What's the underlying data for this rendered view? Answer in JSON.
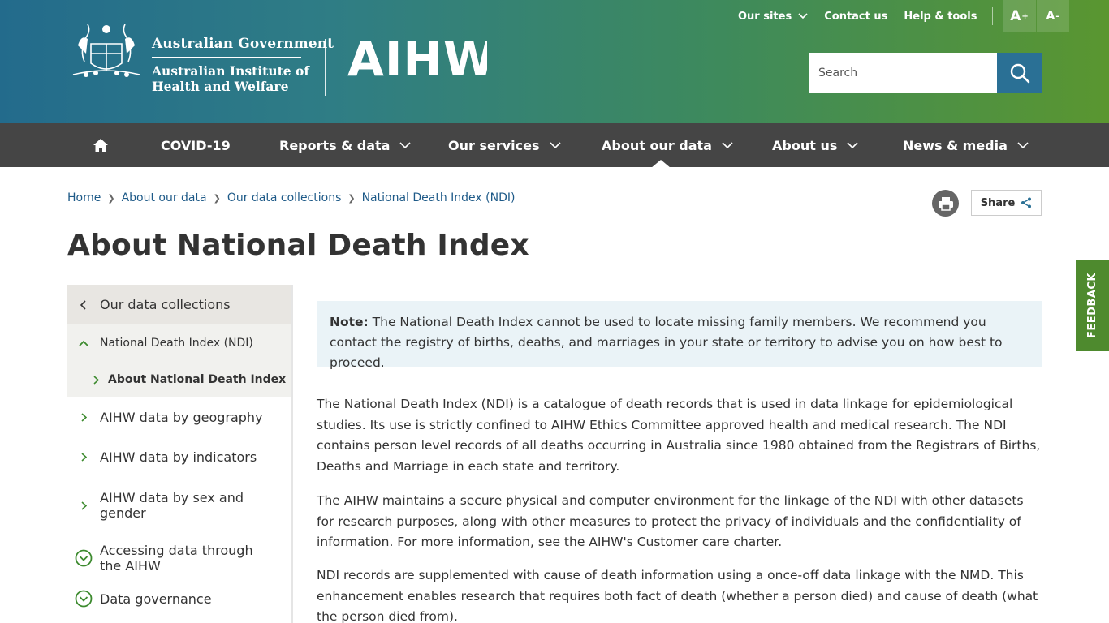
{
  "header": {
    "gov_line1": "Australian Government",
    "gov_line2": "Australian Institute of",
    "gov_line3": "Health and Welfare",
    "brand": "AIHW"
  },
  "util_nav": {
    "our_sites": "Our sites",
    "contact": "Contact us",
    "help": "Help & tools",
    "font_increase": "A",
    "font_increase_sup": "+",
    "font_decrease": "A",
    "font_decrease_sup": "-"
  },
  "search": {
    "placeholder": "Search"
  },
  "main_nav": {
    "covid": "COVID-19",
    "reports": "Reports & data",
    "services": "Our services",
    "about_data": "About our data",
    "about_us": "About us",
    "news": "News & media"
  },
  "breadcrumb": [
    "Home",
    "About our data",
    "Our data collections",
    "National Death Index (NDI)"
  ],
  "share_label": "Share",
  "page_title": "About National Death Index",
  "sidenav": {
    "parent": "Our data collections",
    "ndi": "National Death Index (NDI)",
    "current": "About National Death Index",
    "items": [
      "AIHW data by geography",
      "AIHW data by indicators",
      "AIHW data by sex and gender",
      "Accessing data through the AIHW",
      "Data governance"
    ]
  },
  "note": {
    "label": "Note:",
    "text": " The National Death Index cannot be used to locate missing family members. We recommend you contact the registry of births, deaths, and marriages in your state or territory to advise you on how best to proceed."
  },
  "paragraphs": [
    "The National Death Index (NDI) is a catalogue of death records that is used in data linkage for epidemiological studies. Its use is strictly confined to AIHW Ethics Committee approved health and medical research. The NDI contains person level records of all deaths occurring in Australia since 1980 obtained from the Registrars of Births, Deaths and Marriage in each state and territory.",
    "The AIHW maintains a secure physical and computer environment for the linkage of the NDI with other datasets for research purposes, along with other measures to protect the privacy of individuals and the confidentiality of information. For more information, see the AIHW's Customer care charter.",
    "NDI records are supplemented with cause of death information using a once-off data linkage with the NMD. This enhancement enables research that requires both fact of death (whether a person died) and cause of death (what the person died from)."
  ],
  "feedback": "FEEDBACK",
  "colors": {
    "header_start": "#236b8c",
    "header_end": "#5a9630",
    "nav_bg": "#454545",
    "link": "#1e5a88",
    "note_bg": "#eaf3f7",
    "feedback_bg": "#4e8a2e"
  }
}
